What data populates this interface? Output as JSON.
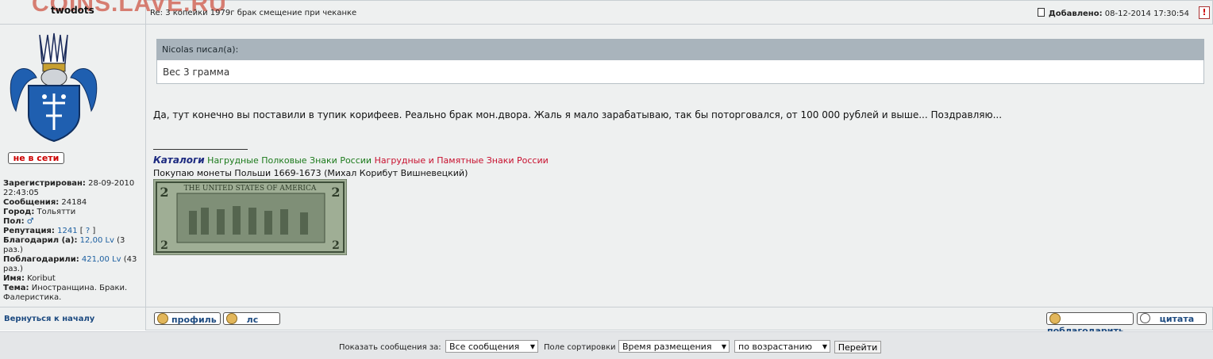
{
  "watermark": "COINS.LAVE.RU",
  "post": {
    "author": "twodots",
    "subject": "Re: 3 копейки 1979г брак смещение при чеканке",
    "added_label": "Добавлено:",
    "added_value": "08-12-2014 17:30:54",
    "report_icon": "!",
    "quote_header": "Nicolas писал(а):",
    "quote_text": "Вес 3 грамма",
    "message": "Да, тут конечно вы поставили в тупик корифеев. Реально брак мон.двора. Жаль я мало зарабатываю, так бы поторговался, от 100 000 рублей и выше... Поздравляю..."
  },
  "signature": {
    "catalog": "Каталоги",
    "link1": "Нагрудные Полковые Знаки России",
    "link2": "Нагрудные и Памятные Знаки России",
    "line2": "Покупаю монеты Польши 1669-1673 (Михал Корибут Вишневецкий)",
    "bill_top": "THE UNITED STATES OF AMERICA",
    "bill_denom": "2"
  },
  "user": {
    "status": "не в сети",
    "registered_label": "Зарегистрирован:",
    "registered_value": "28-09-2010 22:43:05",
    "messages_label": "Сообщения:",
    "messages_value": "24184",
    "city_label": "Город:",
    "city_value": "Тольятти",
    "gender_label": "Пол:",
    "gender_value": "♂",
    "rep_label": "Репутация:",
    "rep_value": "1241",
    "rep_link": "?",
    "thanked_label": "Благодарил (а):",
    "thanked_value": "12,00 Lv",
    "thanked_count": "(3 раз.)",
    "gotthanks_label": "Поблагодарили:",
    "gotthanks_value": "421,00 Lv",
    "gotthanks_count": "(43 раз.)",
    "name_label": "Имя:",
    "name_value": "Koribut",
    "theme_label": "Тема:",
    "theme_value": "Иностранщина. Браки. Фалеристика."
  },
  "actions": {
    "back_top": "Вернуться к началу",
    "profile": "профиль",
    "pm": "лс",
    "thank": "поблагодарить",
    "quote": "цитата"
  },
  "footer": {
    "show_label": "Показать сообщения за:",
    "show_value": "Все сообщения",
    "sort_label": "Поле сортировки",
    "sort_value": "Время размещения",
    "order_value": "по возрастанию",
    "go": "Перейти"
  }
}
